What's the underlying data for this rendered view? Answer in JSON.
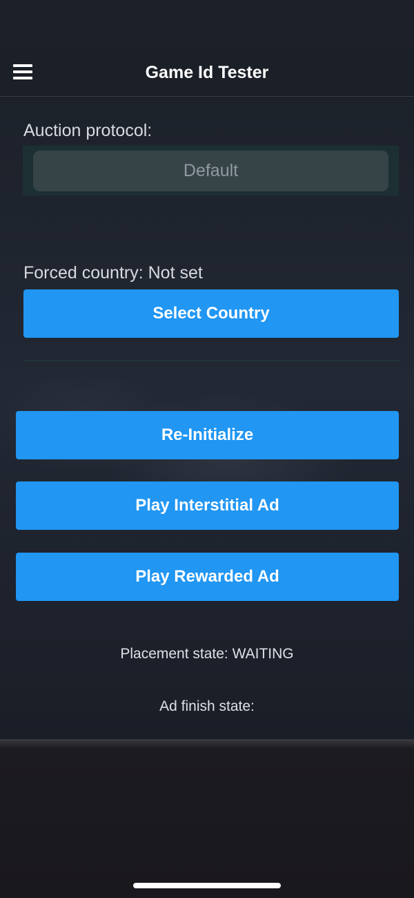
{
  "app": {
    "title": "Game Id Tester",
    "menu_icon": "hamburger-menu-icon"
  },
  "auction": {
    "label": "Auction protocol:",
    "selected": "Default"
  },
  "country": {
    "label": "Forced country: Not set",
    "select_button": "Select Country"
  },
  "actions": {
    "reinitialize": "Re-Initialize",
    "play_interstitial": "Play Interstitial Ad",
    "play_rewarded": "Play Rewarded Ad"
  },
  "status": {
    "placement_state": "Placement state: WAITING",
    "ad_finish_state": "Ad finish state:"
  },
  "colors": {
    "accent": "#2196f3",
    "background": "#1a1e26"
  }
}
